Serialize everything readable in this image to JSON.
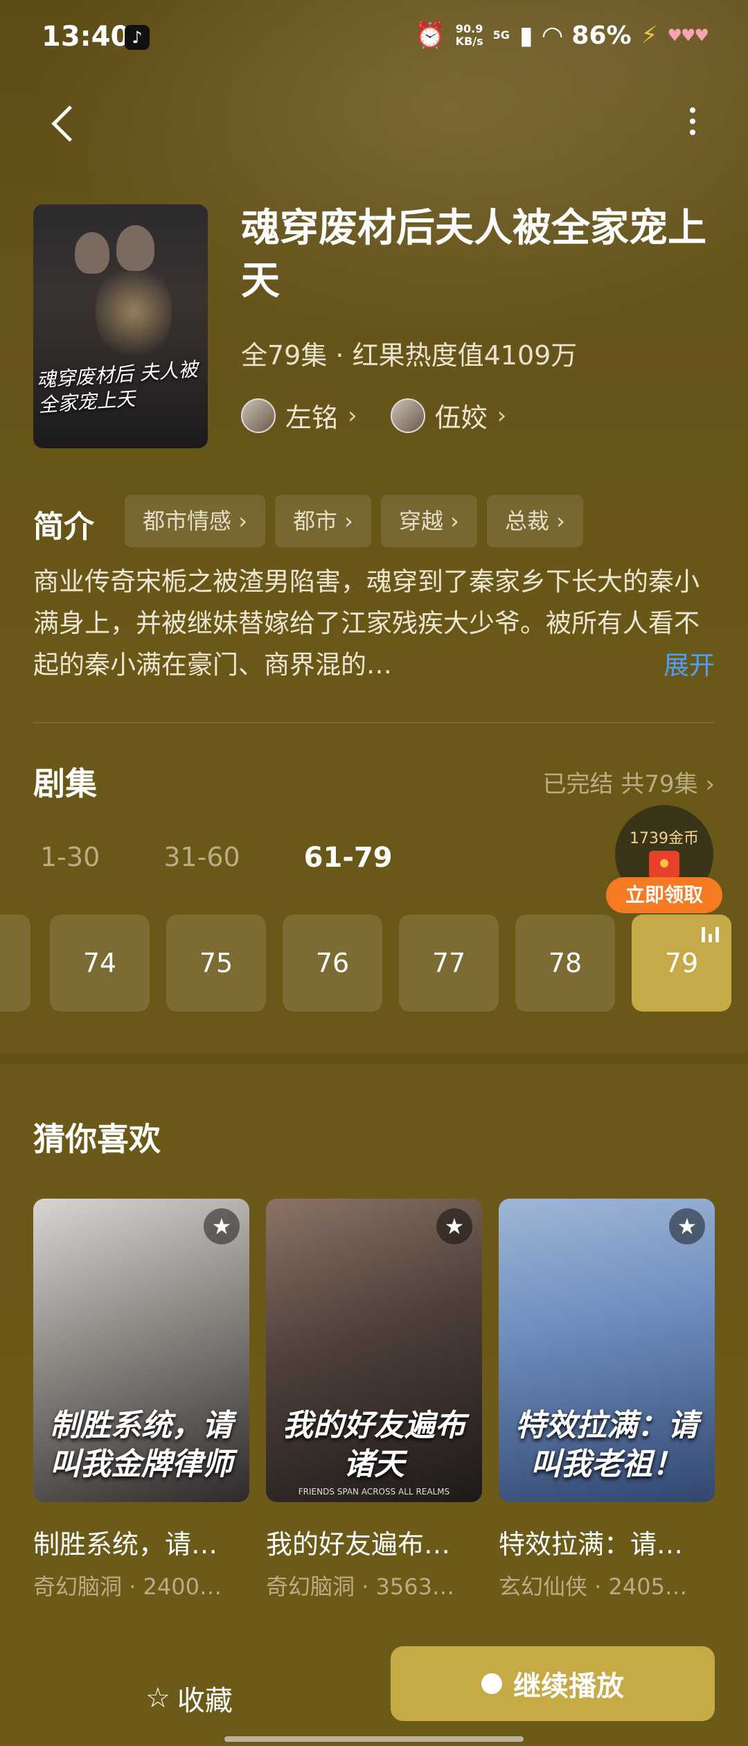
{
  "status_bar": {
    "time": "13:40",
    "net_speed_top": "90.9",
    "net_speed_bottom": "KB/s",
    "network": "5G",
    "battery": "86%"
  },
  "drama": {
    "title": "魂穿废材后夫人被全家宠上天",
    "poster_text": "魂穿废材后 夫人被全家宠上天",
    "meta": "全79集 · 红果热度值4109万",
    "actors": [
      {
        "name": "左铭"
      },
      {
        "name": "伍姣"
      }
    ]
  },
  "intro": {
    "label": "简介",
    "tags": [
      "都市情感",
      "都市",
      "穿越",
      "总裁"
    ],
    "description": "商业传奇宋栀之被渣男陷害，魂穿到了秦家乡下长大的秦小满身上，并被继妹替嫁给了江家残疾大少爷。被所有人看不起的秦小满在豪门、商界混的…",
    "expand": "展开"
  },
  "episodes": {
    "label": "剧集",
    "status": "已完结 共79集",
    "ranges": [
      "1-30",
      "31-60",
      "61-79"
    ],
    "active_range": "61-79",
    "items": [
      "74",
      "75",
      "76",
      "77",
      "78",
      "79"
    ],
    "current": "79"
  },
  "reward": {
    "amount": "1739金币",
    "claim": "立即领取"
  },
  "recommend": {
    "label": "猜你喜欢",
    "items": [
      {
        "cover_text": "制胜系统，请叫我金牌律师",
        "name": "制胜系统，请…",
        "meta": "奇幻脑洞 · 2400…"
      },
      {
        "cover_text": "我的好友遍布诸天",
        "cover_sub": "FRIENDS SPAN ACROSS ALL REALMS",
        "name": "我的好友遍布…",
        "meta": "奇幻脑洞 · 3563…"
      },
      {
        "cover_text": "特效拉满：请叫我老祖！",
        "name": "特效拉满：请…",
        "meta": "玄幻仙侠 · 2405…"
      }
    ]
  },
  "bottom": {
    "favorite": "收藏",
    "play": "继续播放"
  },
  "colors": {
    "accent": "#c7aa48",
    "link": "#4f9ff2",
    "claim": "#f57a21"
  }
}
